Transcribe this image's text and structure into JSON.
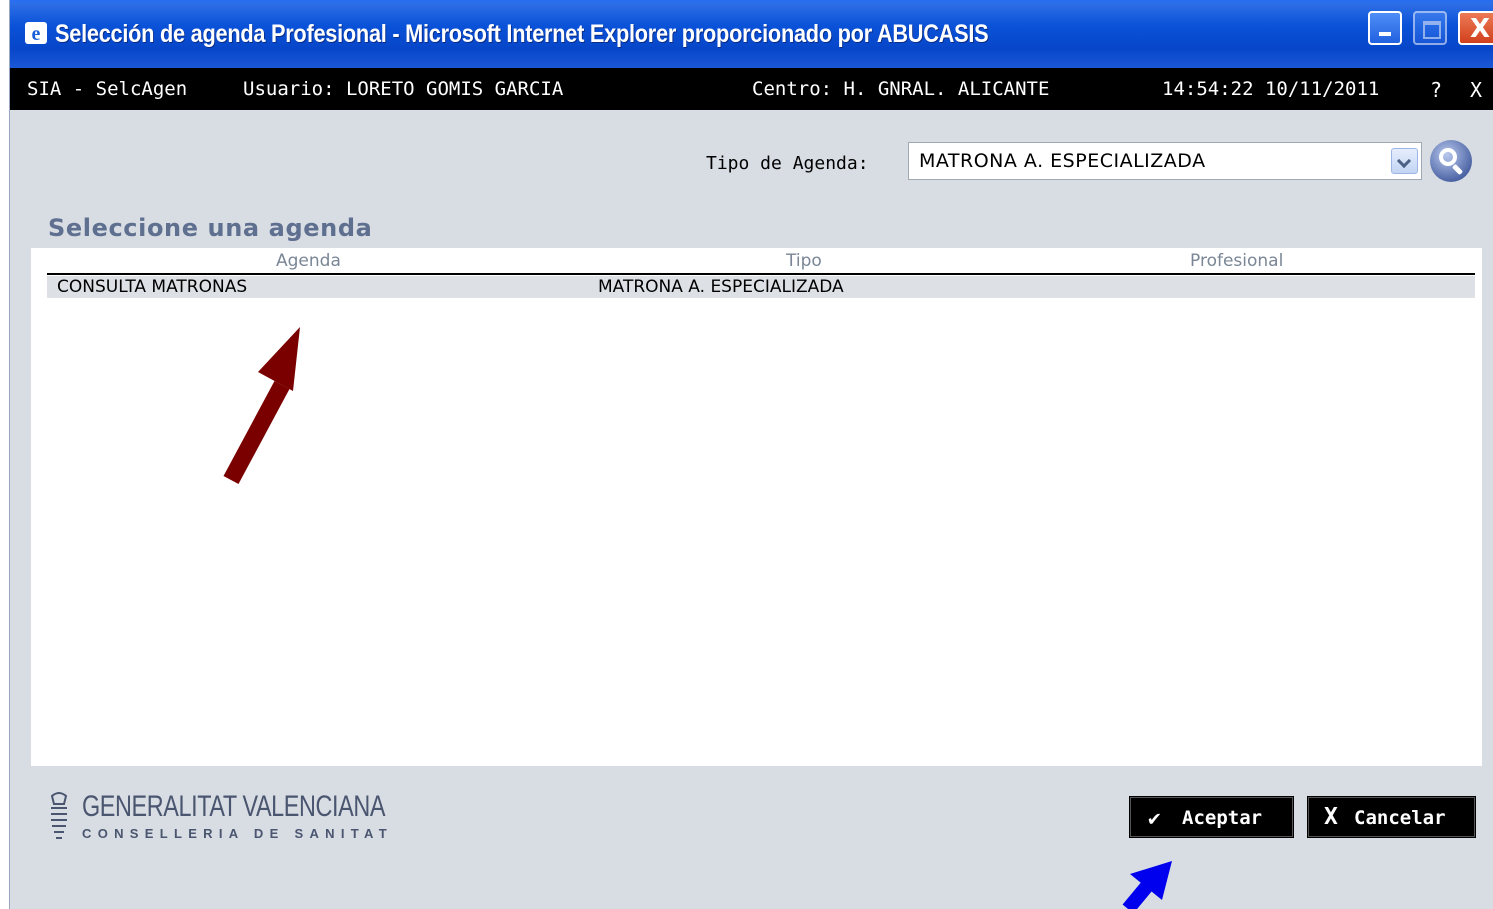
{
  "window": {
    "title": "Selección de agenda Profesional - Microsoft Internet Explorer proporcionado por ABUCASIS",
    "close_glyph": "X"
  },
  "infobar": {
    "app": "SIA - SelcAgen",
    "user": "Usuario: LORETO GOMIS GARCIA",
    "centro": "Centro: H. GNRAL. ALICANTE",
    "datetime": "14:54:22 10/11/2011",
    "help": "?",
    "close": "X"
  },
  "filter": {
    "label": "Tipo de Agenda:",
    "selected": "MATRONA A. ESPECIALIZADA"
  },
  "section_title": "Seleccione una agenda",
  "grid": {
    "headers": [
      "Agenda",
      "Tipo",
      "Profesional"
    ],
    "rows": [
      [
        "CONSULTA MATRONAS",
        "MATRONA A. ESPECIALIZADA",
        ""
      ]
    ]
  },
  "logo": {
    "line1": "GENERALITAT VALENCIANA",
    "line2": "CONSELLERIA DE SANITAT"
  },
  "buttons": {
    "ok": "Aceptar",
    "ok_icon": "✔",
    "cancel": "Cancelar",
    "cancel_icon": "X"
  },
  "colors": {
    "titlebar": "#0a52d8",
    "infobar": "#000000",
    "annotation_arrow_1": "#7a0000",
    "annotation_arrow_2": "#0000ee"
  }
}
